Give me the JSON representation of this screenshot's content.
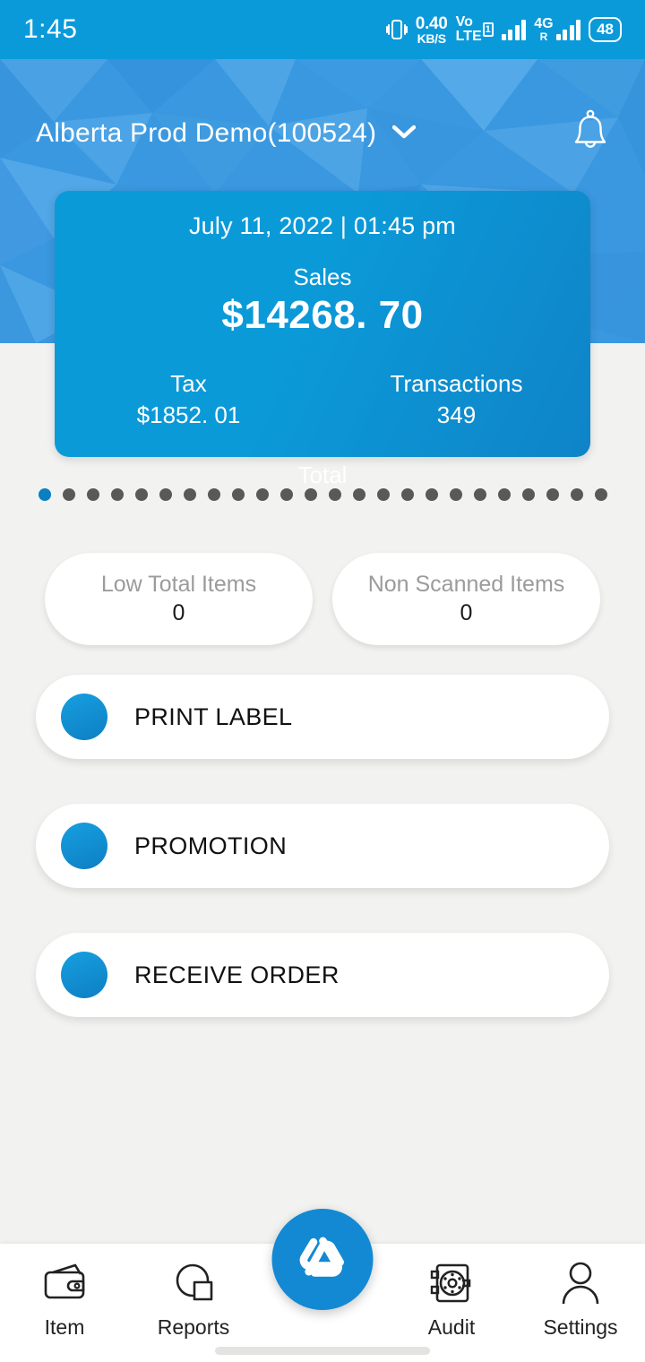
{
  "status_bar": {
    "time": "1:45",
    "net_speed_value": "0.40",
    "net_speed_unit": "KB/S",
    "volte_line1": "Vo",
    "volte_line2": "LTE",
    "volte_badge": "1",
    "roaming": "R",
    "network_type": "4G",
    "battery": "48",
    "icons": [
      "vibrate-icon",
      "network-speed-icon",
      "volte-icon",
      "signal-bars-icon",
      "signal-bars-roaming-icon",
      "battery-icon"
    ]
  },
  "header": {
    "store_name": "Alberta Prod Demo(100524)",
    "dropdown_icon": "chevron-down-icon",
    "notification_icon": "bell-icon"
  },
  "sales_card": {
    "date_time": "July 11,  2022 | 01:45 pm",
    "sales_label": "Sales",
    "sales_value": "$14268. 70",
    "tax_label": "Tax",
    "tax_value": "$1852. 01",
    "transactions_label": "Transactions",
    "transactions_value": "349",
    "total_label": "Total"
  },
  "carousel": {
    "total_dots": 24,
    "active_index": 0
  },
  "stats": [
    {
      "label": "Low Total Items",
      "value": "0"
    },
    {
      "label": "Non Scanned Items",
      "value": "0"
    }
  ],
  "actions": [
    {
      "label": "PRINT LABEL"
    },
    {
      "label": "PROMOTION"
    },
    {
      "label": "RECEIVE ORDER"
    }
  ],
  "bottom_nav": [
    {
      "label": "Item",
      "icon": "wallet-icon"
    },
    {
      "label": "Reports",
      "icon": "pie-chart-icon"
    },
    {
      "label": "Audit",
      "icon": "safe-vault-icon"
    },
    {
      "label": "Settings",
      "icon": "person-icon"
    }
  ],
  "fab": {
    "icon": "triangle-spiral-logo-icon"
  },
  "colors": {
    "status_bar": "#0a9ada",
    "header": "#3a98e0",
    "card_start": "#0b9ad8",
    "card_end": "#0f84c8",
    "accent": "#1389d3",
    "page_bg": "#f2f2f0",
    "dot_inactive": "#595959",
    "dot_active": "#0a7fc2"
  }
}
